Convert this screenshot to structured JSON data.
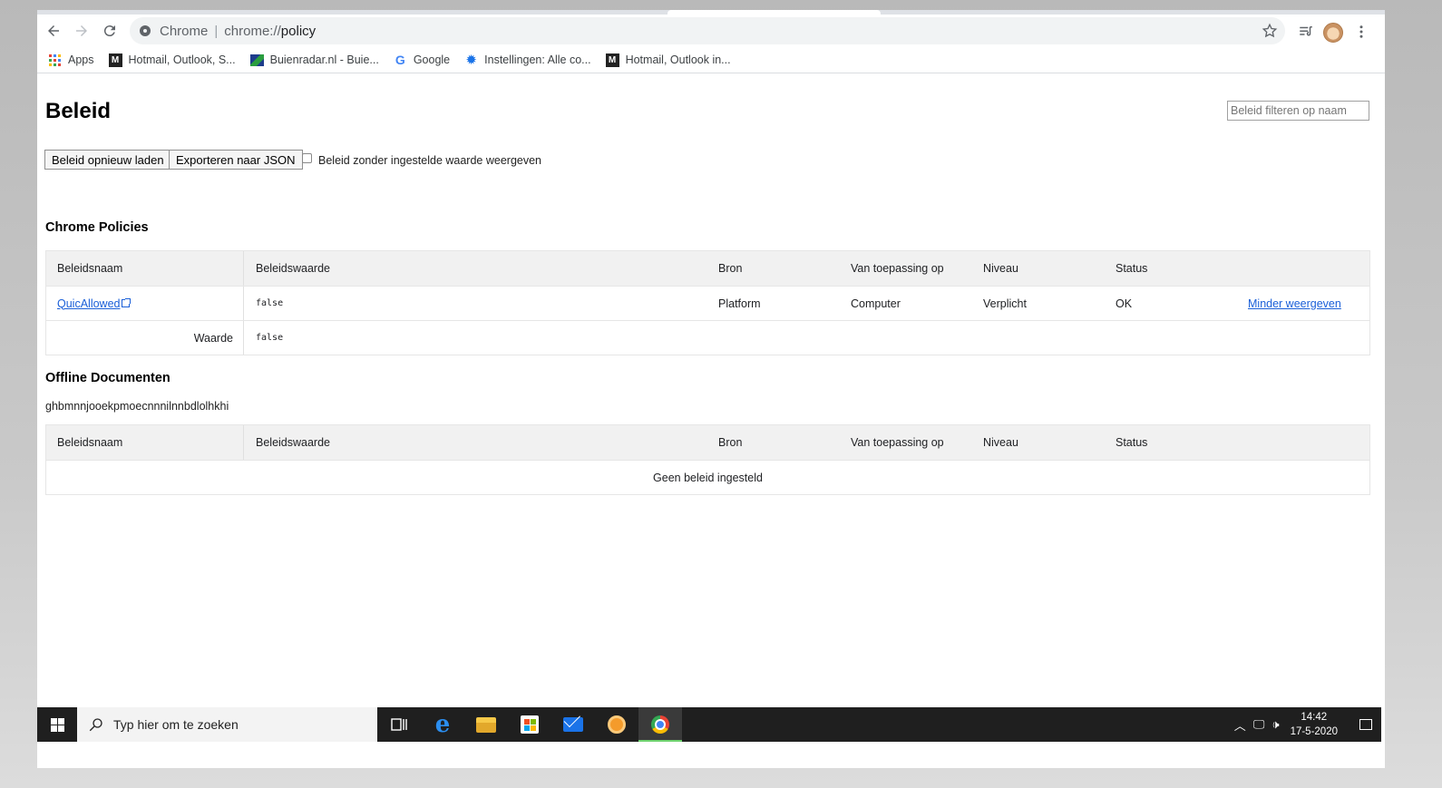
{
  "browser": {
    "omnibox": {
      "chip": "Chrome",
      "separator": "|",
      "scheme": "chrome://",
      "path": "policy"
    },
    "bookmarks": [
      {
        "label": "Apps",
        "icon": "apps-grid-icon"
      },
      {
        "label": "Hotmail, Outlook, S...",
        "icon": "msn-icon"
      },
      {
        "label": "Buienradar.nl - Buie...",
        "icon": "buienradar-icon"
      },
      {
        "label": "Google",
        "icon": "google-icon"
      },
      {
        "label": "Instellingen: Alle co...",
        "icon": "gear-icon"
      },
      {
        "label": "Hotmail, Outlook in...",
        "icon": "msn-icon"
      }
    ]
  },
  "page": {
    "title": "Beleid",
    "filter_placeholder": "Beleid filteren op naam",
    "reload_button": "Beleid opnieuw laden",
    "export_button": "Exporteren naar JSON",
    "show_unset_label": "Beleid zonder ingestelde waarde weergeven"
  },
  "columns": {
    "name": "Beleidsnaam",
    "value": "Beleidswaarde",
    "source": "Bron",
    "scope": "Van toepassing op",
    "level": "Niveau",
    "status": "Status"
  },
  "chrome_policies": {
    "title": "Chrome Policies",
    "row": {
      "name": "QuicAllowed",
      "value": "false",
      "source": "Platform",
      "scope": "Computer",
      "level": "Verplicht",
      "status": "OK",
      "toggle": "Minder weergeven"
    },
    "detail": {
      "label": "Waarde",
      "value": "false"
    }
  },
  "offline_docs": {
    "title": "Offline Documenten",
    "extension_id": "ghbmnnjooekpmoecnnnilnnbdlolhkhi",
    "empty_message": "Geen beleid ingesteld"
  },
  "taskbar": {
    "search_placeholder": "Typ hier om te zoeken",
    "time": "14:42",
    "date": "17-5-2020"
  },
  "colors": {
    "link": "#1a5fd8",
    "taskbar": "#1f1f1f",
    "table_header": "#f1f1f1"
  }
}
